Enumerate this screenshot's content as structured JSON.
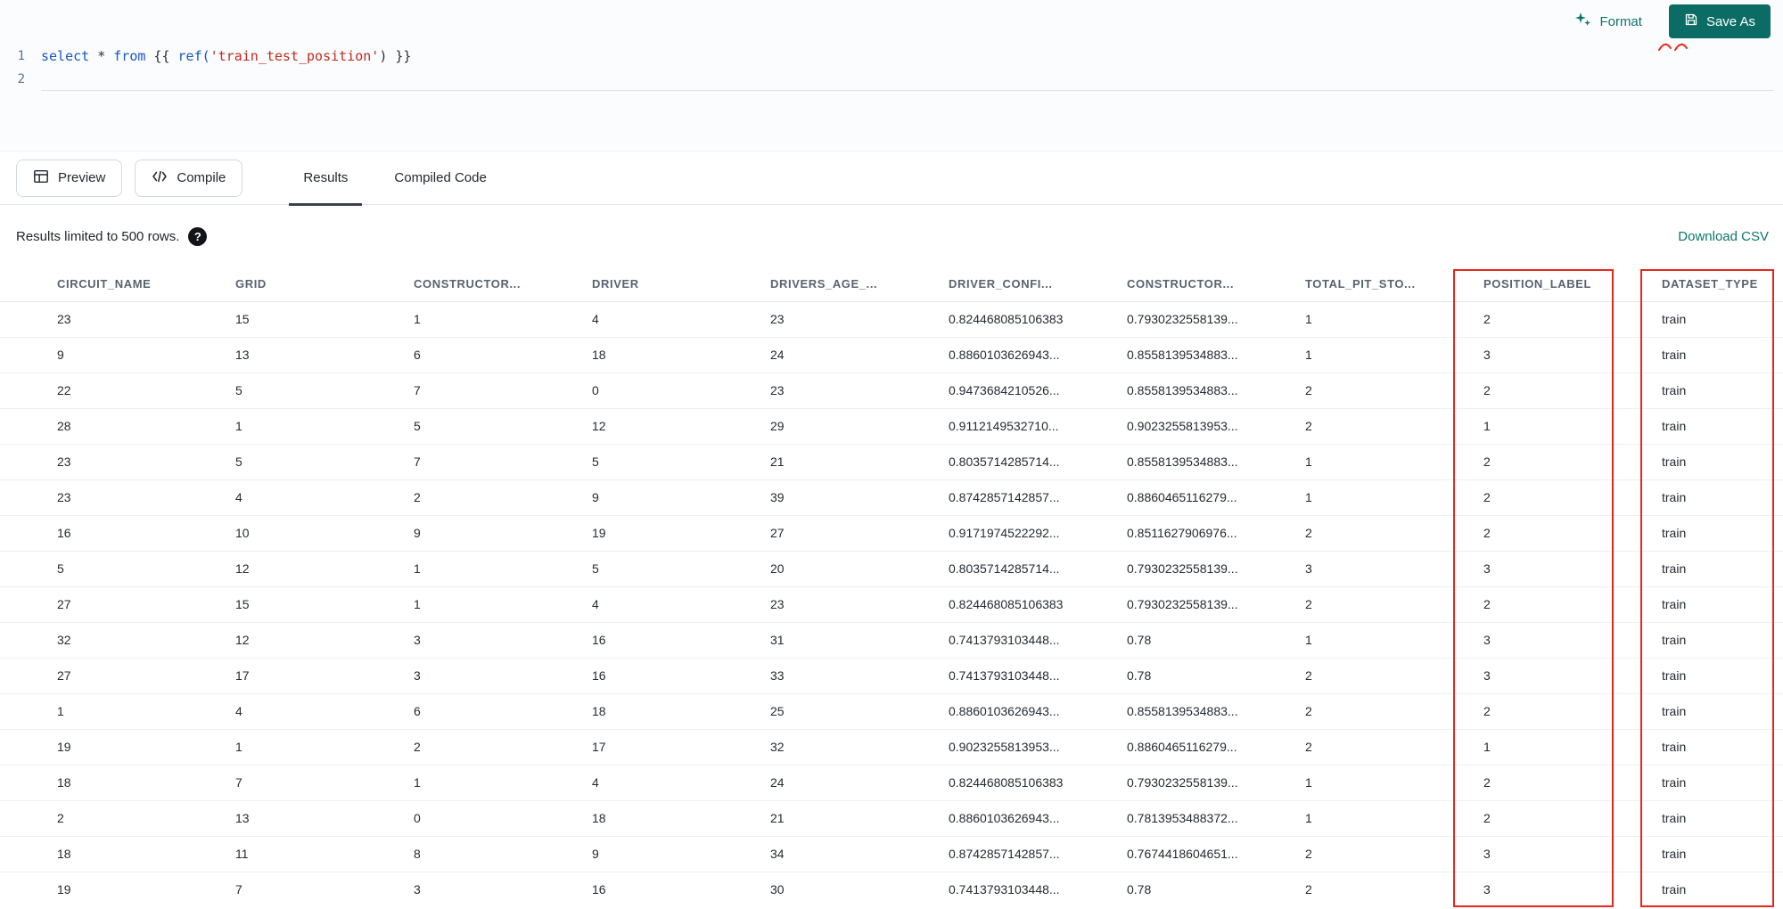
{
  "topbar": {
    "format_label": "Format",
    "save_as_label": "Save As"
  },
  "editor": {
    "line_numbers": [
      "1",
      "2"
    ],
    "tokens": [
      {
        "c": "kw",
        "v": "select"
      },
      {
        "c": "p",
        "v": " "
      },
      {
        "c": "op",
        "v": "*"
      },
      {
        "c": "p",
        "v": " "
      },
      {
        "c": "kw",
        "v": "from"
      },
      {
        "c": "p",
        "v": " {{ "
      },
      {
        "c": "fn",
        "v": "ref("
      },
      {
        "c": "str",
        "v": "'train_test_position'"
      },
      {
        "c": "p",
        "v": ") }}"
      }
    ]
  },
  "toolbar": {
    "preview_label": "Preview",
    "compile_label": "Compile"
  },
  "tabs": [
    {
      "label": "Results",
      "active": true
    },
    {
      "label": "Compiled Code",
      "active": false
    }
  ],
  "results": {
    "limit_note": "Results limited to 500 rows.",
    "help_glyph": "?",
    "download_csv_label": "Download CSV",
    "columns": [
      "CIRCUIT_NAME",
      "GRID",
      "CONSTRUCTOR...",
      "DRIVER",
      "DRIVERS_AGE_...",
      "DRIVER_CONFI...",
      "CONSTRUCTOR...",
      "TOTAL_PIT_STO...",
      "POSITION_LABEL",
      "DATASET_TYPE"
    ],
    "rows": [
      [
        "23",
        "15",
        "1",
        "4",
        "23",
        "0.824468085106383",
        "0.7930232558139...",
        "1",
        "2",
        "train"
      ],
      [
        "9",
        "13",
        "6",
        "18",
        "24",
        "0.8860103626943...",
        "0.8558139534883...",
        "1",
        "3",
        "train"
      ],
      [
        "22",
        "5",
        "7",
        "0",
        "23",
        "0.9473684210526...",
        "0.8558139534883...",
        "2",
        "2",
        "train"
      ],
      [
        "28",
        "1",
        "5",
        "12",
        "29",
        "0.9112149532710...",
        "0.9023255813953...",
        "2",
        "1",
        "train"
      ],
      [
        "23",
        "5",
        "7",
        "5",
        "21",
        "0.8035714285714...",
        "0.8558139534883...",
        "1",
        "2",
        "train"
      ],
      [
        "23",
        "4",
        "2",
        "9",
        "39",
        "0.8742857142857...",
        "0.8860465116279...",
        "1",
        "2",
        "train"
      ],
      [
        "16",
        "10",
        "9",
        "19",
        "27",
        "0.9171974522292...",
        "0.8511627906976...",
        "2",
        "2",
        "train"
      ],
      [
        "5",
        "12",
        "1",
        "5",
        "20",
        "0.8035714285714...",
        "0.7930232558139...",
        "3",
        "3",
        "train"
      ],
      [
        "27",
        "15",
        "1",
        "4",
        "23",
        "0.824468085106383",
        "0.7930232558139...",
        "2",
        "2",
        "train"
      ],
      [
        "32",
        "12",
        "3",
        "16",
        "31",
        "0.7413793103448...",
        "0.78",
        "1",
        "3",
        "train"
      ],
      [
        "27",
        "17",
        "3",
        "16",
        "33",
        "0.7413793103448...",
        "0.78",
        "2",
        "3",
        "train"
      ],
      [
        "1",
        "4",
        "6",
        "18",
        "25",
        "0.8860103626943...",
        "0.8558139534883...",
        "2",
        "2",
        "train"
      ],
      [
        "19",
        "1",
        "2",
        "17",
        "32",
        "0.9023255813953...",
        "0.8860465116279...",
        "2",
        "1",
        "train"
      ],
      [
        "18",
        "7",
        "1",
        "4",
        "24",
        "0.824468085106383",
        "0.7930232558139...",
        "1",
        "2",
        "train"
      ],
      [
        "2",
        "13",
        "0",
        "18",
        "21",
        "0.8860103626943...",
        "0.7813953488372...",
        "1",
        "2",
        "train"
      ],
      [
        "18",
        "11",
        "8",
        "9",
        "34",
        "0.8742857142857...",
        "0.7674418604651...",
        "2",
        "3",
        "train"
      ],
      [
        "19",
        "7",
        "3",
        "16",
        "30",
        "0.7413793103448...",
        "0.78",
        "2",
        "3",
        "train"
      ]
    ]
  },
  "colors": {
    "accent_teal": "#0d756c",
    "save_button_bg": "#0a6c64",
    "annotation_red": "#e8271c",
    "keyword_blue": "#1657c2",
    "string_red": "#c22a1f"
  }
}
